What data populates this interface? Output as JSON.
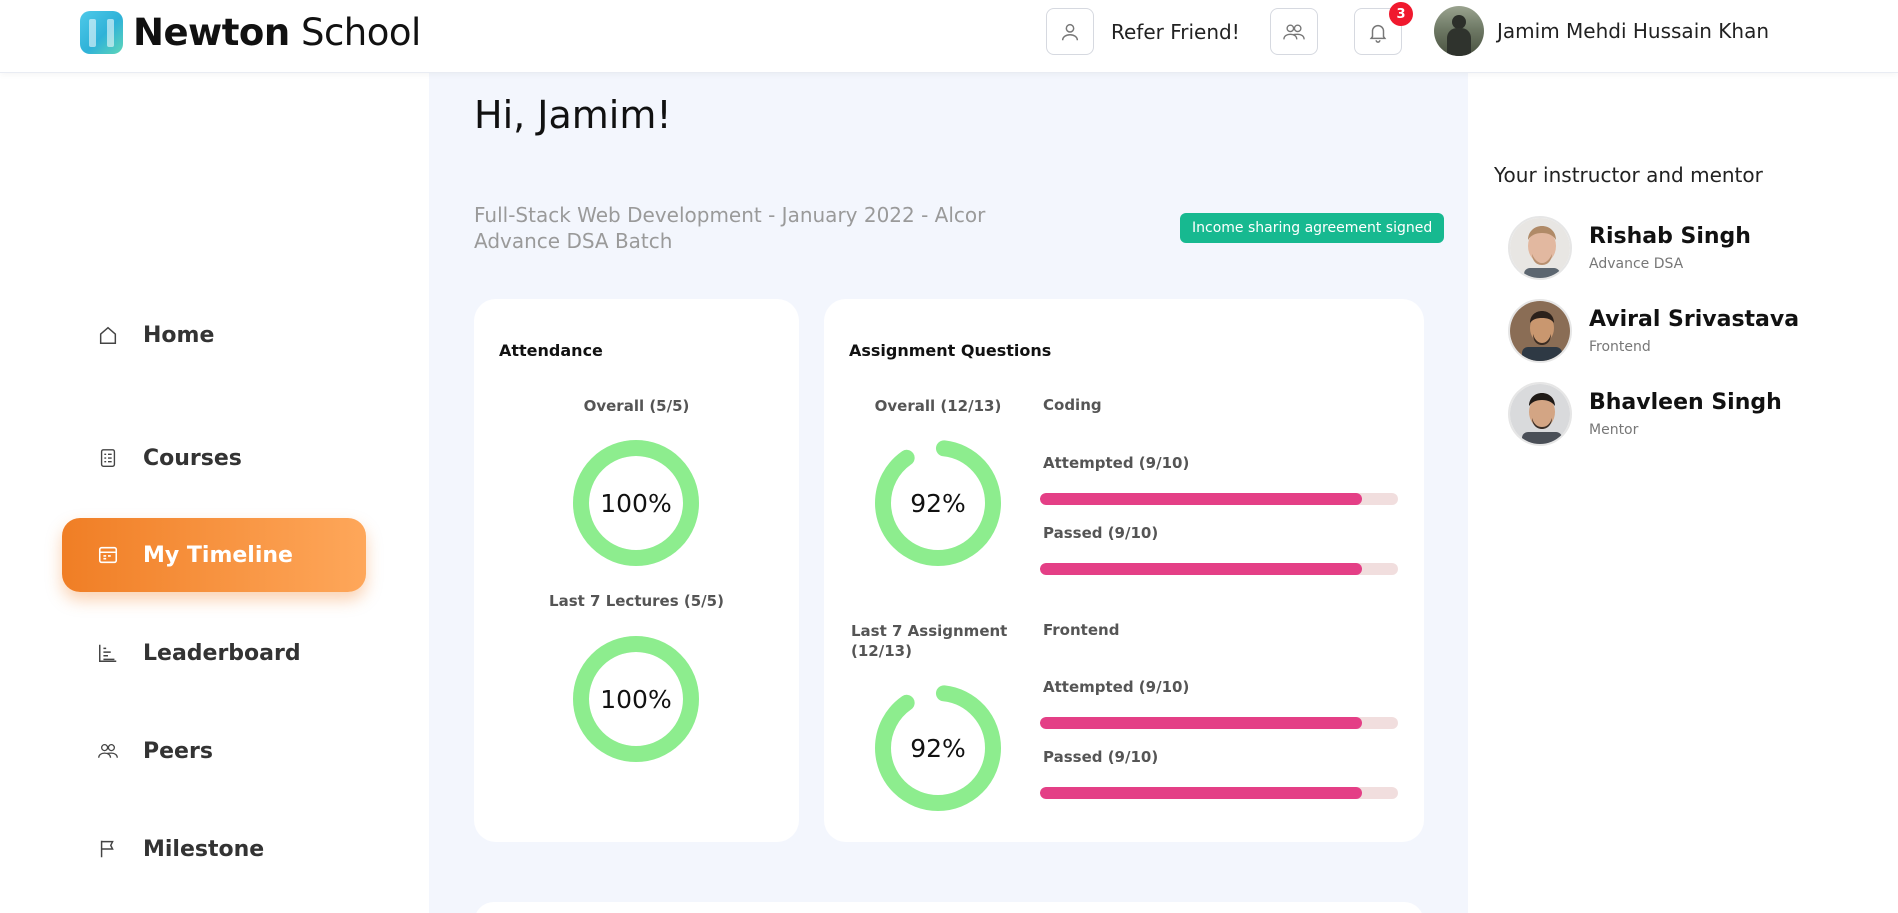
{
  "brand": {
    "name_bold": "Newton",
    "name_light": "School"
  },
  "header": {
    "refer_label": "Refer Friend!",
    "notification_count": "3",
    "user_name": "Jamim Mehdi Hussain Khan"
  },
  "sidebar": {
    "items": [
      {
        "label": "Home",
        "icon": "home-icon"
      },
      {
        "label": "Courses",
        "icon": "courses-icon"
      },
      {
        "label": "My Timeline",
        "icon": "timeline-icon",
        "active": true
      },
      {
        "label": "Leaderboard",
        "icon": "leaderboard-icon"
      },
      {
        "label": "Peers",
        "icon": "peers-icon"
      },
      {
        "label": "Milestone",
        "icon": "flag-icon"
      }
    ]
  },
  "main": {
    "greeting": "Hi, Jamim!",
    "course_title": "Full-Stack Web Development - January 2022 - Alcor Advance DSA Batch",
    "isa_badge": "Income sharing agreement signed",
    "attendance": {
      "title": "Attendance",
      "overall_label": "Overall (5/5)",
      "overall_value": "100%",
      "overall_fraction": 1.0,
      "last7_label": "Last 7 Lectures (5/5)",
      "last7_value": "100%",
      "last7_fraction": 1.0
    },
    "assignments": {
      "title": "Assignment Questions",
      "overall_label": "Overall (12/13)",
      "overall_value": "92%",
      "overall_fraction": 0.92,
      "last7_label": "Last 7 Assignment (12/13)",
      "last7_value": "92%",
      "last7_fraction": 0.92,
      "coding": {
        "heading": "Coding",
        "attempted_label": "Attempted (9/10)",
        "attempted_fraction": 0.9,
        "passed_label": "Passed (9/10)",
        "passed_fraction": 0.9
      },
      "frontend": {
        "heading": "Frontend",
        "attempted_label": "Attempted (9/10)",
        "attempted_fraction": 0.9,
        "passed_label": "Passed (9/10)",
        "passed_fraction": 0.9
      }
    }
  },
  "mentors": {
    "heading": "Your instructor and mentor",
    "list": [
      {
        "name": "Rishab Singh",
        "role": "Advance DSA"
      },
      {
        "name": "Aviral Srivastava",
        "role": "Frontend"
      },
      {
        "name": "Bhavleen Singh",
        "role": "Mentor"
      }
    ]
  },
  "colors": {
    "accent_orange": "#f07e25",
    "ring_green": "#8ded8e",
    "bar_pink": "#e43f86",
    "isa_green": "#17b990"
  }
}
